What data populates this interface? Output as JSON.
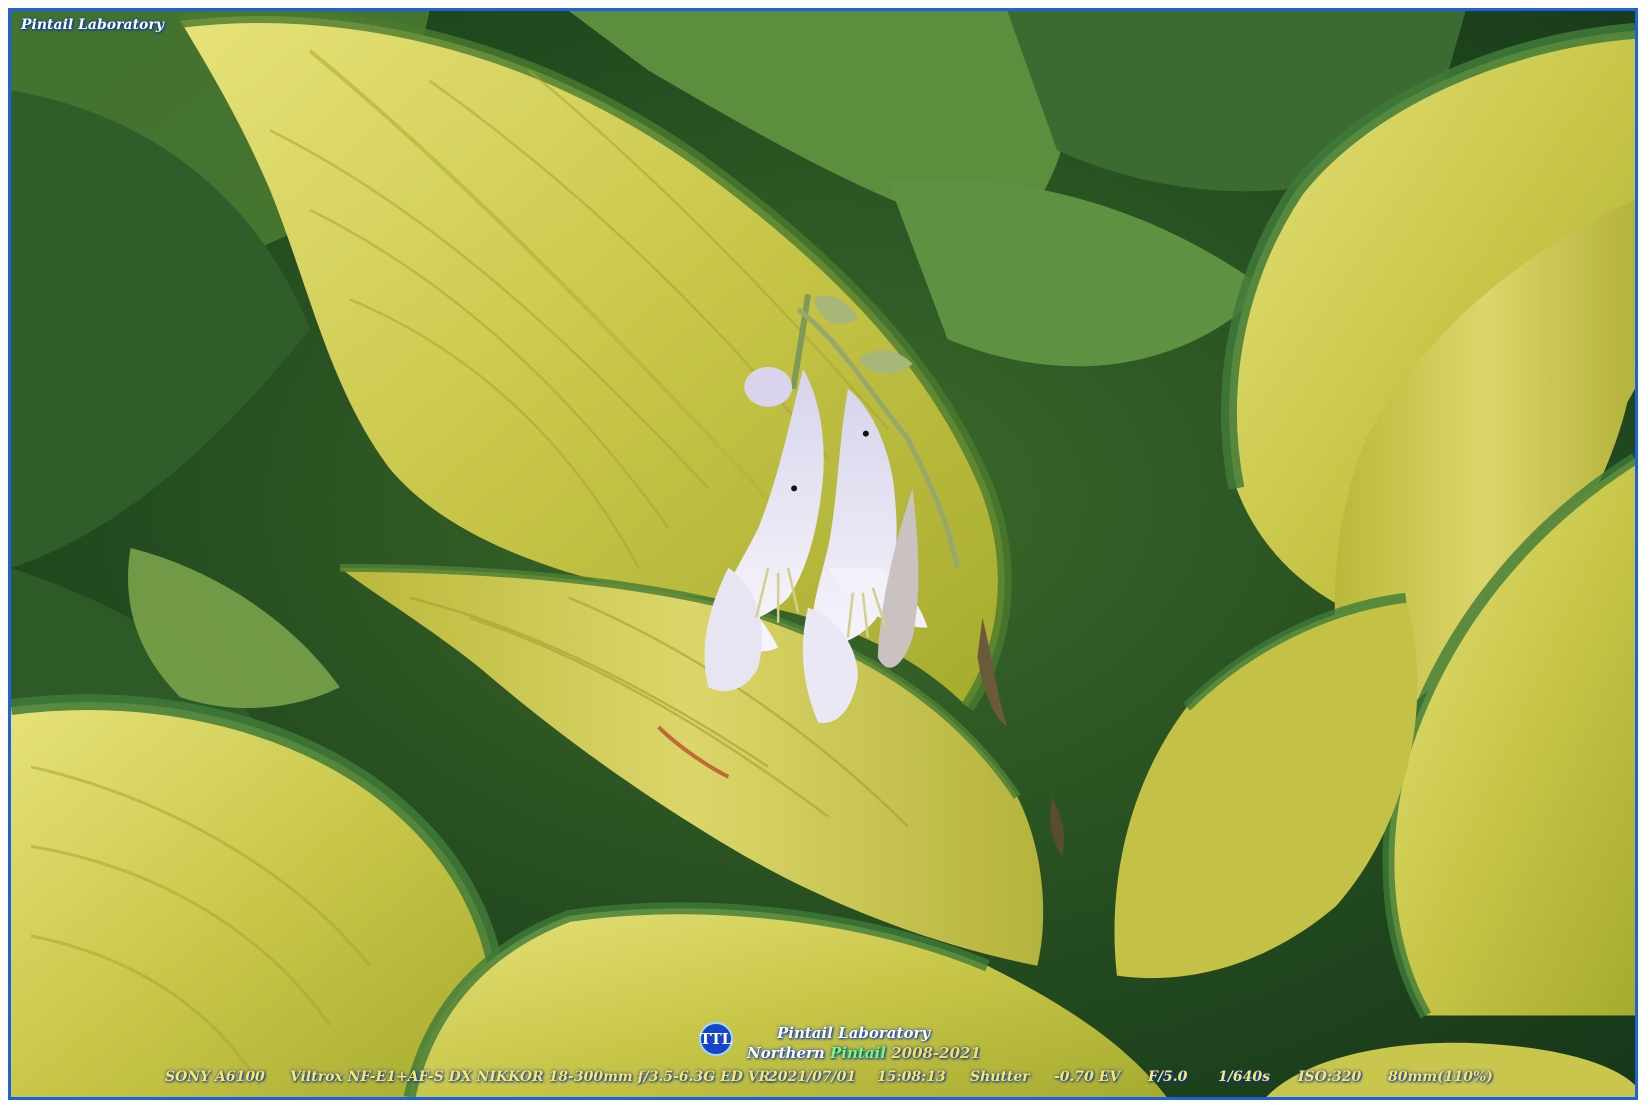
{
  "photo": {
    "subject": "hosta-flowers",
    "border_color": "#1e62d8"
  },
  "watermark": {
    "top_left": "Pintail Laboratory",
    "logo_text": "TTL",
    "brand_line1": "Pintail Laboratory",
    "brand_line2_a": "Northern ",
    "brand_line2_b": "Pintail",
    "brand_line2_c": " 2008-2021"
  },
  "exif": {
    "camera": "SONY A6100",
    "lens": "Viltrox NF-E1+AF-S DX NIKKOR 18-300mm f/3.5-6.3G ED VR",
    "date": "2021/07/01",
    "time": "15:08:13",
    "mode": "Shutter",
    "ev": "-0.70 EV",
    "aperture": "F/5.0",
    "shutter": "1/640s",
    "iso": "ISO:320",
    "focal": "80mm(110%)"
  }
}
